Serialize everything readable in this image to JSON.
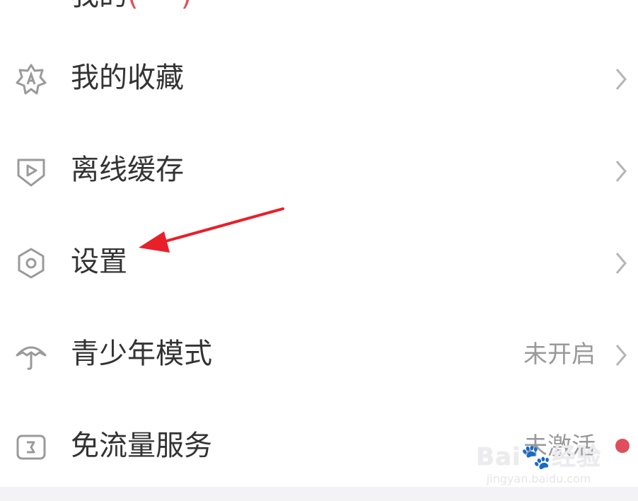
{
  "top_partial": {
    "text": "我的",
    "accent_text": "(***)"
  },
  "menu": {
    "items": [
      {
        "label": "我的收藏",
        "icon": "star-badge-icon"
      },
      {
        "label": "离线缓存",
        "icon": "play-download-icon"
      },
      {
        "label": "设置",
        "icon": "hexagon-gear-icon"
      },
      {
        "label": "青少年模式",
        "value": "未开启",
        "icon": "umbrella-icon"
      },
      {
        "label": "免流量服务",
        "value": "未激活",
        "icon": "data-card-icon"
      }
    ]
  },
  "watermark": {
    "brand": "Bai🐾经验",
    "url": "jingyan.baidu.com"
  },
  "colors": {
    "accent": "#e04e5c",
    "arrow": "#e8202a",
    "text": "#333333",
    "muted": "#999999"
  }
}
